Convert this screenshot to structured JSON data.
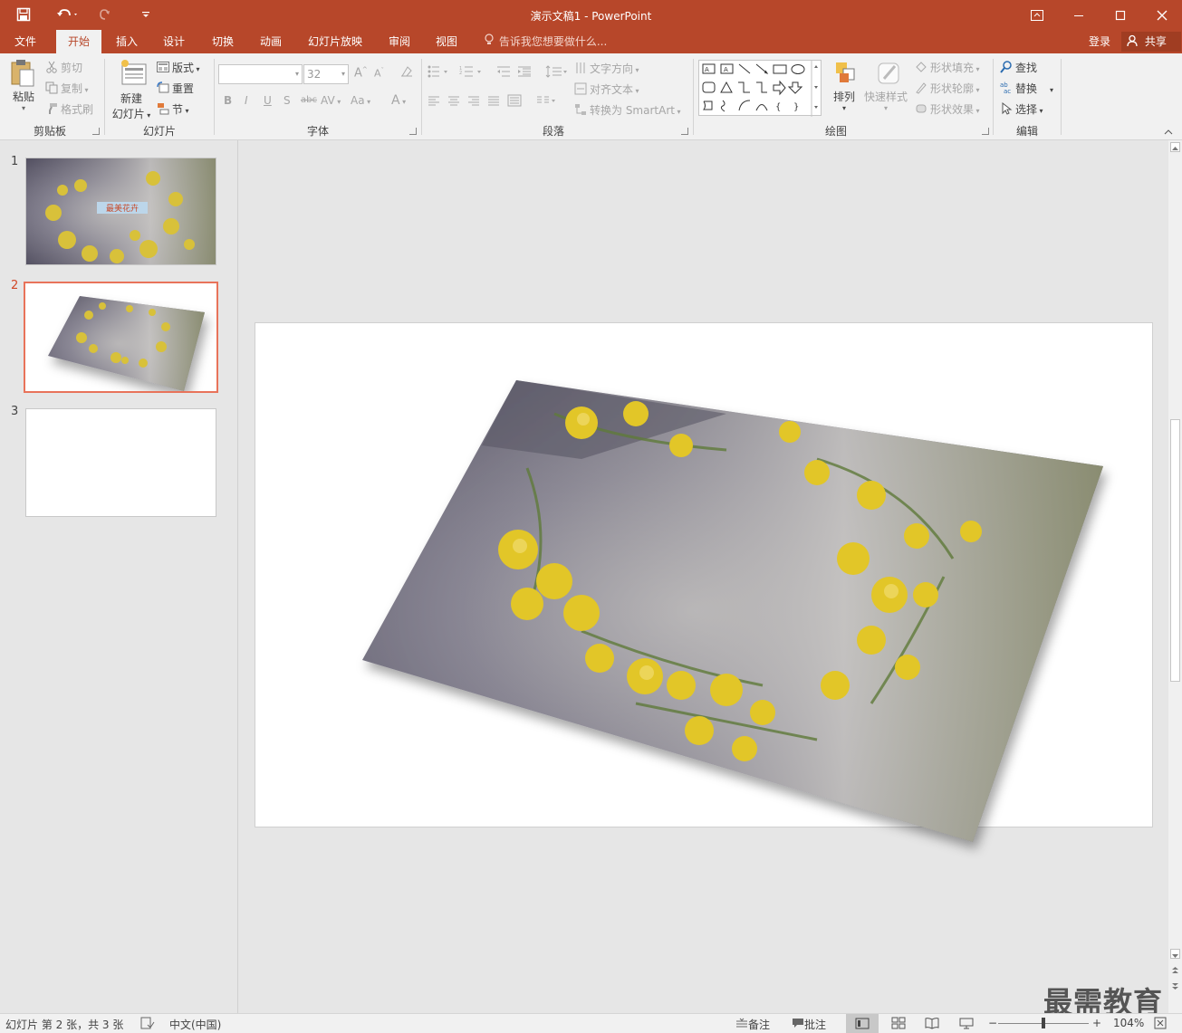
{
  "app": {
    "title": "演示文稿1 - PowerPoint"
  },
  "tabs": [
    {
      "label": "文件",
      "active": false
    },
    {
      "label": "开始",
      "active": true
    },
    {
      "label": "插入",
      "active": false
    },
    {
      "label": "设计",
      "active": false
    },
    {
      "label": "切换",
      "active": false
    },
    {
      "label": "动画",
      "active": false
    },
    {
      "label": "幻灯片放映",
      "active": false
    },
    {
      "label": "审阅",
      "active": false
    },
    {
      "label": "视图",
      "active": false
    }
  ],
  "tell_me": "告诉我您想要做什么...",
  "account": {
    "login": "登录",
    "share": "共享"
  },
  "ribbon": {
    "clipboard": {
      "paste": "粘贴",
      "cut": "剪切",
      "copy": "复制",
      "format_painter": "格式刷",
      "label": "剪贴板"
    },
    "slides": {
      "new_slide_1": "新建",
      "new_slide_2": "幻灯片",
      "layout": "版式",
      "reset": "重置",
      "section": "节",
      "label": "幻灯片"
    },
    "font": {
      "font_size": "32",
      "label": "字体"
    },
    "paragraph": {
      "text_direction": "文字方向",
      "align_text": "对齐文本",
      "smartart": "转换为 SmartArt",
      "label": "段落"
    },
    "drawing": {
      "arrange": "排列",
      "quick_styles": "快速样式",
      "shape_fill": "形状填充",
      "shape_outline": "形状轮廓",
      "shape_effects": "形状效果",
      "label": "绘图"
    },
    "editing": {
      "find": "查找",
      "replace": "替换",
      "select": "选择",
      "label": "编辑"
    }
  },
  "thumbnails": [
    {
      "number": "1",
      "selected": false,
      "caption": "最美花卉"
    },
    {
      "number": "2",
      "selected": true
    },
    {
      "number": "3",
      "selected": false
    }
  ],
  "status": {
    "slide_info": "幻灯片 第 2 张，共 3 张",
    "language": "中文(中国)",
    "notes": "备注",
    "comments": "批注",
    "zoom": "104%"
  },
  "watermark": "最需教育",
  "colors": {
    "accent": "#b7472a",
    "selection": "#e8735a"
  }
}
